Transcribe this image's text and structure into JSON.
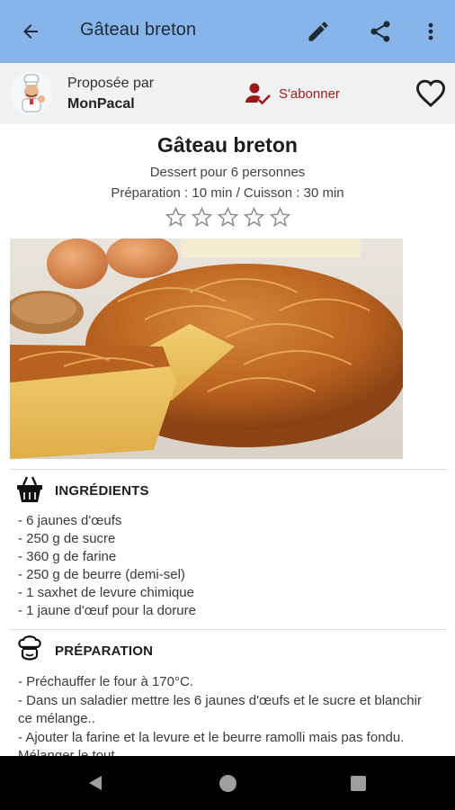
{
  "appbar": {
    "title": "Gâteau breton",
    "back_icon": "arrow-back-icon",
    "edit_icon": "pencil-icon",
    "share_icon": "share-icon",
    "more_icon": "more-vert-icon",
    "background": "#87b5e9"
  },
  "author": {
    "proposed_label": "Proposée par",
    "name": "MonPacal",
    "subscribe_label": "S'abonner",
    "subscribe_color": "#9b1b1b",
    "favorite_icon": "heart-outline-icon"
  },
  "recipe": {
    "title": "Gâteau breton",
    "servings": "Dessert pour 6 personnes",
    "times": "Préparation : 10 min / Cuisson : 30 min",
    "rating": 0,
    "rating_max": 5
  },
  "ingredients": {
    "heading": "INGRÉDIENTS",
    "icon": "basket-icon",
    "items": [
      "- 6 jaunes d'œufs",
      "- 250 g de sucre",
      "- 360 g de farine",
      "- 250 g de beurre (demi-sel)",
      "- 1 saxhet de levure chimique",
      "- 1 jaune d'œuf pour la dorure"
    ]
  },
  "preparation": {
    "heading": "PRÉPARATION",
    "icon": "chef-hat-icon",
    "lines": [
      "- Préchauffer le four à 170°C.",
      "- Dans un saladier mettre les 6 jaunes d'œufs et le sucre et blanchir ce mélange..",
      "- Ajouter la farine et la levure et le beurre ramolli mais pas fondu. Mélanger le tout."
    ]
  },
  "system_nav": {
    "back_icon": "nav-back-icon",
    "home_icon": "nav-home-icon",
    "recent_icon": "nav-recents-icon"
  }
}
